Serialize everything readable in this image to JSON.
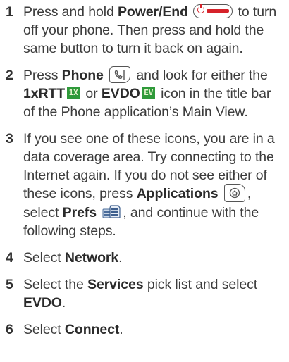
{
  "colors": {
    "text": "#3c3c3c",
    "power_red": "#d6222a",
    "badge_green": "#2f9a3a"
  },
  "steps": [
    {
      "number": "1",
      "t1": "Press and hold ",
      "b1": "Power/End",
      "t2": " to turn off your phone. Then press and hold the same button to turn it back on again.",
      "icon": "power-end-button-icon"
    },
    {
      "number": "2",
      "t1": "Press ",
      "b1": "Phone",
      "t2": " and look for either the ",
      "b2": "1xRTT",
      "badge1": "1X",
      "t3": " or ",
      "b3": "EVDO",
      "badge2": "EV",
      "t4": " icon in the title bar of the Phone application’s Main View.",
      "icon": "phone-button-icon"
    },
    {
      "number": "3",
      "t1": "If you see one of these icons, you are in a data coverage area. Try connecting to the Internet again. If you do not see either of these icons, press ",
      "b1": "Applications",
      "t2": ", select ",
      "b2": "Prefs",
      "t3": ", and continue with the following steps.",
      "icon1": "applications-button-icon",
      "icon2": "prefs-icon"
    },
    {
      "number": "4",
      "t1": "Select ",
      "b1": "Network",
      "t2": "."
    },
    {
      "number": "5",
      "t1": "Select the ",
      "b1": "Services",
      "t2": " pick list and select ",
      "b2": "EVDO",
      "t3": "."
    },
    {
      "number": "6",
      "t1": "Select ",
      "b1": "Connect",
      "t2": "."
    }
  ]
}
